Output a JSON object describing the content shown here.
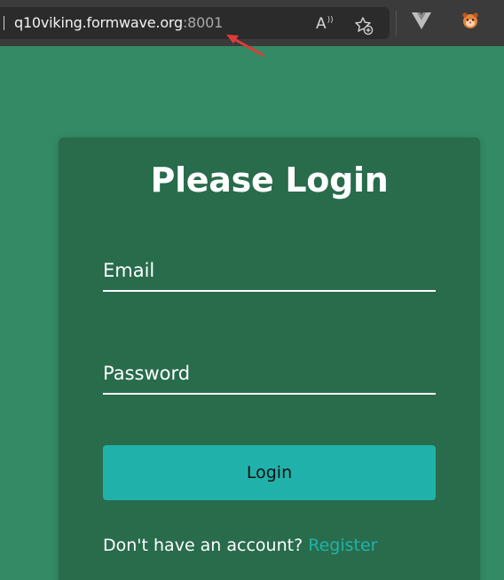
{
  "browser": {
    "url_host": "q10viking.formwave.org",
    "url_port": ":8001",
    "read_aloud_label": "A"
  },
  "login": {
    "title": "Please Login",
    "email_placeholder": "Email",
    "password_placeholder": "Password",
    "submit_label": "Login",
    "footer_prompt": "Don't have an account?",
    "register_label": "Register"
  },
  "colors": {
    "page_bg": "#338a64",
    "card_bg": "#286c4c",
    "button_bg": "#20b2aa",
    "link": "#20b2aa"
  }
}
